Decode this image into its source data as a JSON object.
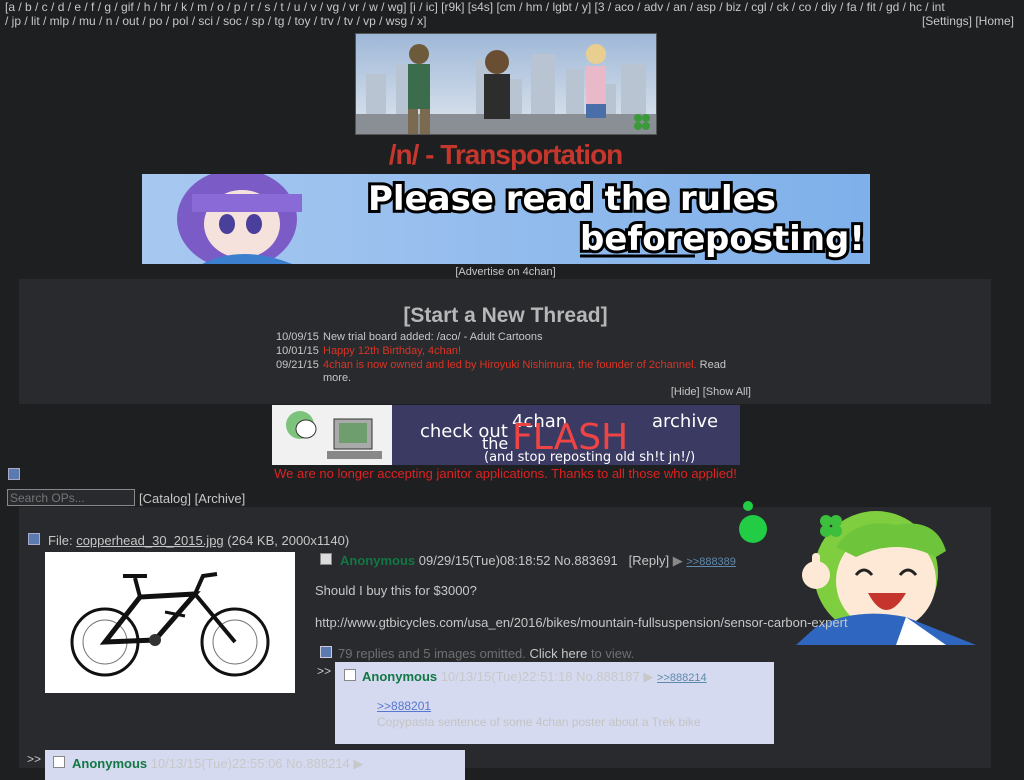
{
  "nav": {
    "boards_line1": "[a / b / c / d / e / f / g / gif / h / hr / k / m / o / p / r / s / t / u / v / vg / vr / w / wg] [i / ic] [r9k] [s4s] [cm / hm / lgbt / y] [3 / aco / adv / an / asp / biz / cgl / ck / co / diy / fa / fit / gd / hc / int",
    "boards_line2": "/ jp / lit / mlp / mu / n / out / po / pol / sci / soc / sp / tg / toy / trv / tv / vp / wsg / x]",
    "settings": "[Settings]",
    "home": "[Home]"
  },
  "board": {
    "title": "/n/ - Transportation",
    "advertise": "[Advertise on 4chan]",
    "rules_line1": "Please read the rules",
    "rules_line2a": "before",
    "rules_line2b": "posting!"
  },
  "global": {
    "start_thread": "[Start a New Thread]",
    "news": [
      {
        "date": "10/09/15",
        "text": "New trial board added: /aco/ - Adult Cartoons"
      },
      {
        "date": "10/01/15",
        "text": "Happy 12th Birthday, 4chan!"
      },
      {
        "date": "09/21/15",
        "text": "4chan is now owned and led by Hiroyuki Nishimura, the founder of 2channel.",
        "more": "Read more."
      }
    ],
    "hide": "[Hide]",
    "show_all": "[Show All]"
  },
  "flash_ad": {
    "line1": "check out",
    "brand": "4chan",
    "line2": "the",
    "flash": "FLASH",
    "line3": "archive",
    "line4": "(and stop reposting old sh!t jn!/)"
  },
  "janitor_notice": "We are no longer accepting janitor applications. Thanks to all those who applied!",
  "controls": {
    "search_placeholder": "Search OPs...",
    "catalog": "[Catalog]",
    "archive": "[Archive]"
  },
  "op": {
    "file_label": "File:",
    "file_name": "copperhead_30_2015.jpg",
    "file_meta": "(264 KB, 2000x1140)",
    "name": "Anonymous",
    "datetime": "09/29/15(Tue)08:18:52",
    "post_no": "No.883691",
    "reply": "[Reply]",
    "arrow": "▶",
    "backlink": ">>888389",
    "body_line1": "Should I buy this for $3000?",
    "body_line2": "http://www.gtbicycles.com/usa_en/2016/bikes/mountain-fullsuspension/sensor-carbon-expert",
    "omitted_text": "79 replies and 5 images omitted.",
    "click_here": "Click here",
    "to_view": "to view."
  },
  "replies": [
    {
      "arrows": ">>",
      "name": "Anonymous",
      "meta": "10/13/15(Tue)22:51:18 No.888187",
      "arrow": "▶",
      "backlink": ">>888214",
      "quote": ">>888201",
      "text": "Copypasta sentence of some 4chan poster about a Trek bike"
    },
    {
      "arrows": ">>",
      "name": "Anonymous",
      "meta": "10/13/15(Tue)22:55:06 No.888214",
      "arrow": "▶"
    }
  ],
  "colors": {
    "background": "#1d1f21",
    "panel": "#282a2e",
    "title_red": "#c5372c",
    "name_green": "#117743",
    "reply_bg": "#d6daf0"
  }
}
